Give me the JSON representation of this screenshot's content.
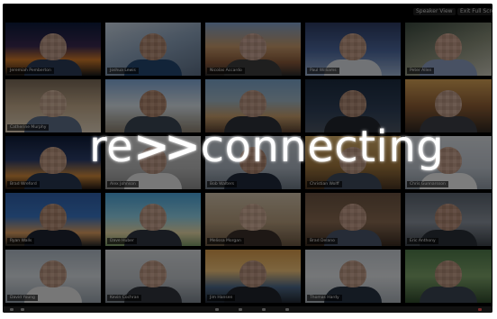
{
  "window": {
    "speaker_view_label": "Speaker View",
    "exit_fullscreen_label": "Exit Full Screen"
  },
  "logo": {
    "prefix": "re",
    "chevrons": ">>",
    "suffix": "connecting"
  },
  "tiles": [
    {
      "name": "Jeremiah Pemberton",
      "bg": "linear-gradient(180deg,#0c1a3a 0%,#3b2a50 45%,#d17a2a 70%,#1b1b1b 100%)",
      "shirt": "#2b3a55",
      "skin": "#c09a86"
    },
    {
      "name": "Joshua Lewis",
      "bg": "linear-gradient(160deg,#c7d3e0 0%,#8aa0b9 50%,#5d6f86 100%)",
      "shirt": "#24466e",
      "skin": "#b78c74"
    },
    {
      "name": "Nicolas Accardo",
      "bg": "linear-gradient(180deg,#7e9fc8 0%,#c79a6b 45%,#8a5a3a 75%,#2c2c2c 100%)",
      "shirt": "#3c3c3c",
      "skin": "#c7a08e"
    },
    {
      "name": "Paul Williams",
      "bg": "linear-gradient(180deg,#2c3a60 0%,#4e6aa0 55%,#9eb2d0 100%)",
      "shirt": "#d9dde3",
      "skin": "#c49a82"
    },
    {
      "name": "Peter Allen",
      "bg": "linear-gradient(160deg,#3b4a3f 0%,#8a8f7a 55%,#c8c6b8 100%)",
      "shirt": "#8a9cbf",
      "skin": "#caa08a"
    },
    {
      "name": "Catherine Murphy",
      "bg": "linear-gradient(180deg,#7a6a58 0%,#c2a98a 50%,#e0d2bc 100%)",
      "shirt": "#5d6d86",
      "skin": "#d0ae96"
    },
    {
      "name": "",
      "bg": "linear-gradient(180deg,#7fa7d6 0%,#d7e0e6 50%,#8d8270 100%)",
      "shirt": "#3b4554",
      "skin": "#b78a70"
    },
    {
      "name": "",
      "bg": "linear-gradient(180deg,#7aa3c9 0%,#9fb5c4 40%,#c79d6a 70%,#5b4332 100%)",
      "shirt": "#2d3138",
      "skin": "#c29a84"
    },
    {
      "name": "",
      "bg": "linear-gradient(180deg,#1b2a3e 0%,#2f4058 60%,#4b5563 100%)",
      "shirt": "#22262c",
      "skin": "#b38a73"
    },
    {
      "name": "",
      "bg": "linear-gradient(180deg,#d6a256 0%,#8f5f35 50%,#2f2620 100%)",
      "shirt": "#3c3f46",
      "skin": "#c9a38d"
    },
    {
      "name": "Brad Wreford",
      "bg": "linear-gradient(180deg,#0f1c36 0%,#2c3e6a 45%,#d28b3c 75%,#241a14 100%)",
      "shirt": "#27364f",
      "skin": "#c59b82"
    },
    {
      "name": "Alex Johnson",
      "bg": "linear-gradient(180deg,#d4d4d4 0%,#b8b8b8 60%,#8c8c8c 100%)",
      "shirt": "#e6e6e6",
      "skin": "#c39c88"
    },
    {
      "name": "Bob Walters",
      "bg": "linear-gradient(180deg,#c8cfd6 0%,#aab4bf 60%,#6d7885 100%)",
      "shirt": "#1f2a3a",
      "skin": "#b98c74"
    },
    {
      "name": "Christian Wolff",
      "bg": "linear-gradient(180deg,#d8b06a 0%,#a47a3e 55%,#4a3523 100%)",
      "shirt": "#3f4a5a",
      "skin": "#c79f88"
    },
    {
      "name": "Chris Gunnarsson",
      "bg": "linear-gradient(180deg,#d9dde2 0%,#bfc6cf 60%,#8f98a4 100%)",
      "shirt": "#f0f0f0",
      "skin": "#caa28c"
    },
    {
      "name": "Ryan Walls",
      "bg": "linear-gradient(180deg,#2f5fa8 0%,#3b76c4 45%,#e0a060 75%,#2a2a2a 100%)",
      "shirt": "#1d2330",
      "skin": "#b98d74"
    },
    {
      "name": "Dave Huber",
      "bg": "linear-gradient(180deg,#4aa3d8 0%,#8fd0e6 45%,#e8d8a8 75%,#7c9a6a 100%)",
      "shirt": "#2e3440",
      "skin": "#c7a08a"
    },
    {
      "name": "Melissa Morgan",
      "bg": "linear-gradient(180deg,#cfc0a8 0%,#b59c7c 55%,#6b5742 100%)",
      "shirt": "#3a2f2a",
      "skin": "#d2ad95"
    },
    {
      "name": "Brad Delano",
      "bg": "linear-gradient(180deg,#6a5240 0%,#8a6b52 55%,#3a2c22 100%)",
      "shirt": "#49556a",
      "skin": "#c39a84"
    },
    {
      "name": "Eric Anthony",
      "bg": "linear-gradient(180deg,#5b6470 0%,#8a929c 55%,#3d434b 100%)",
      "shirt": "#2a2f36",
      "skin": "#bb8f78"
    },
    {
      "name": "David Young",
      "bg": "linear-gradient(180deg,#aeb9c4 0%,#d8dde2 50%,#9aa4ae 100%)",
      "shirt": "#e4e4e4",
      "skin": "#c59d86"
    },
    {
      "name": "Kevin Cochran",
      "bg": "linear-gradient(180deg,#d9dcdf 0%,#bfc4c9 55%,#7d8690 100%)",
      "shirt": "#30353c",
      "skin": "#c9a18a"
    },
    {
      "name": "Jim Hansen",
      "bg": "linear-gradient(180deg,#d79a4a 0%,#f0c37a 40%,#4f6a8a 70%,#232a33 100%)",
      "shirt": "#20242b",
      "skin": "#bf9680"
    },
    {
      "name": "Thomas Hardy",
      "bg": "linear-gradient(180deg,#c7cdd3 0%,#e1e4e7 50%,#a9b0b8 100%)",
      "shirt": "#273242",
      "skin": "#c8a08a"
    },
    {
      "name": "",
      "bg": "linear-gradient(180deg,#4f7a4a 0%,#7ea36a 50%,#2f4a2c 100%)",
      "shirt": "#3b4452",
      "skin": "#bf977f"
    }
  ]
}
